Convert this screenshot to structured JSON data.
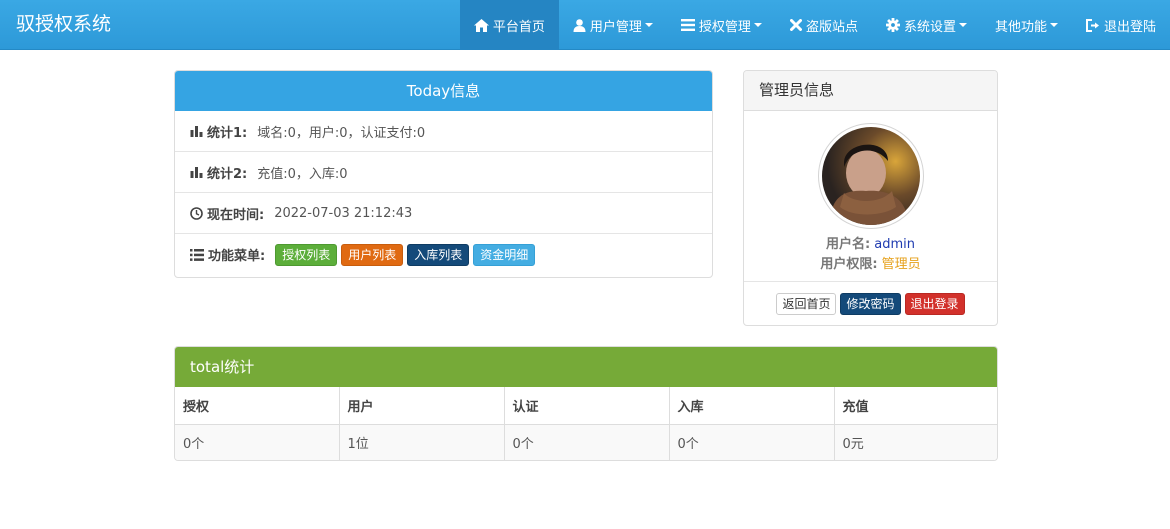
{
  "brand": "驭授权系统",
  "nav": [
    {
      "label": "平台首页",
      "icon": "home-icon",
      "active": true,
      "dropdown": false
    },
    {
      "label": "用户管理",
      "icon": "user-icon",
      "active": false,
      "dropdown": true
    },
    {
      "label": "授权管理",
      "icon": "list-icon",
      "active": false,
      "dropdown": true
    },
    {
      "label": "盗版站点",
      "icon": "close-icon",
      "active": false,
      "dropdown": false
    },
    {
      "label": "系统设置",
      "icon": "gear-icon",
      "active": false,
      "dropdown": true
    },
    {
      "label": "其他功能",
      "icon": "",
      "active": false,
      "dropdown": true
    },
    {
      "label": "退出登陆",
      "icon": "logout-icon",
      "active": false,
      "dropdown": false
    }
  ],
  "today": {
    "title": "Today信息",
    "stat1_label": "统计1:",
    "stat1_value": "域名:0，用户:0，认证支付:0",
    "stat2_label": "统计2:",
    "stat2_value": "充值:0，入库:0",
    "time_label": "现在时间:",
    "time_value": "2022-07-03 21:12:43",
    "menu_label": "功能菜单:",
    "menu_buttons": [
      "授权列表",
      "用户列表",
      "入库列表",
      "资金明细"
    ]
  },
  "admin": {
    "title": "管理员信息",
    "username_label": "用户名:",
    "username": "admin",
    "role_label": "用户权限:",
    "role": "管理员",
    "buttons": {
      "home": "返回首页",
      "change_password": "修改密码",
      "logout": "退出登录"
    }
  },
  "total": {
    "title": "total统计",
    "headers": [
      "授权",
      "用户",
      "认证",
      "入库",
      "充值"
    ],
    "values": [
      "0个",
      "1位",
      "0个",
      "0个",
      "0元"
    ]
  },
  "colors": {
    "navbar": "#35a4e3",
    "today_header": "#35a4e3",
    "total_header": "#76aa38",
    "btn_green": "#5cae3a",
    "btn_orange": "#e06a12",
    "btn_navy": "#144a7a",
    "btn_sky": "#44ade2",
    "btn_red": "#d2312b",
    "role_color": "#e6a11c",
    "username_color": "#1f3bb0"
  }
}
